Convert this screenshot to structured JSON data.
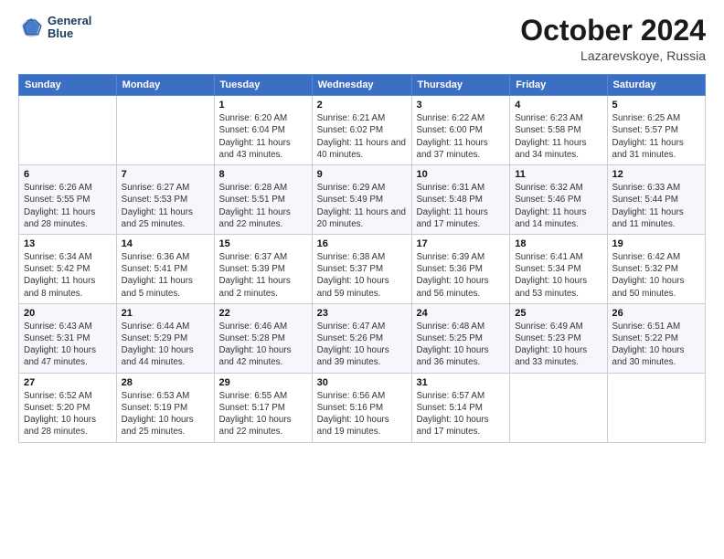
{
  "header": {
    "logo_line1": "General",
    "logo_line2": "Blue",
    "title": "October 2024",
    "subtitle": "Lazarevskoye, Russia"
  },
  "columns": [
    "Sunday",
    "Monday",
    "Tuesday",
    "Wednesday",
    "Thursday",
    "Friday",
    "Saturday"
  ],
  "weeks": [
    [
      {
        "day": "",
        "info": ""
      },
      {
        "day": "",
        "info": ""
      },
      {
        "day": "1",
        "info": "Sunrise: 6:20 AM\nSunset: 6:04 PM\nDaylight: 11 hours and 43 minutes."
      },
      {
        "day": "2",
        "info": "Sunrise: 6:21 AM\nSunset: 6:02 PM\nDaylight: 11 hours and 40 minutes."
      },
      {
        "day": "3",
        "info": "Sunrise: 6:22 AM\nSunset: 6:00 PM\nDaylight: 11 hours and 37 minutes."
      },
      {
        "day": "4",
        "info": "Sunrise: 6:23 AM\nSunset: 5:58 PM\nDaylight: 11 hours and 34 minutes."
      },
      {
        "day": "5",
        "info": "Sunrise: 6:25 AM\nSunset: 5:57 PM\nDaylight: 11 hours and 31 minutes."
      }
    ],
    [
      {
        "day": "6",
        "info": "Sunrise: 6:26 AM\nSunset: 5:55 PM\nDaylight: 11 hours and 28 minutes."
      },
      {
        "day": "7",
        "info": "Sunrise: 6:27 AM\nSunset: 5:53 PM\nDaylight: 11 hours and 25 minutes."
      },
      {
        "day": "8",
        "info": "Sunrise: 6:28 AM\nSunset: 5:51 PM\nDaylight: 11 hours and 22 minutes."
      },
      {
        "day": "9",
        "info": "Sunrise: 6:29 AM\nSunset: 5:49 PM\nDaylight: 11 hours and 20 minutes."
      },
      {
        "day": "10",
        "info": "Sunrise: 6:31 AM\nSunset: 5:48 PM\nDaylight: 11 hours and 17 minutes."
      },
      {
        "day": "11",
        "info": "Sunrise: 6:32 AM\nSunset: 5:46 PM\nDaylight: 11 hours and 14 minutes."
      },
      {
        "day": "12",
        "info": "Sunrise: 6:33 AM\nSunset: 5:44 PM\nDaylight: 11 hours and 11 minutes."
      }
    ],
    [
      {
        "day": "13",
        "info": "Sunrise: 6:34 AM\nSunset: 5:42 PM\nDaylight: 11 hours and 8 minutes."
      },
      {
        "day": "14",
        "info": "Sunrise: 6:36 AM\nSunset: 5:41 PM\nDaylight: 11 hours and 5 minutes."
      },
      {
        "day": "15",
        "info": "Sunrise: 6:37 AM\nSunset: 5:39 PM\nDaylight: 11 hours and 2 minutes."
      },
      {
        "day": "16",
        "info": "Sunrise: 6:38 AM\nSunset: 5:37 PM\nDaylight: 10 hours and 59 minutes."
      },
      {
        "day": "17",
        "info": "Sunrise: 6:39 AM\nSunset: 5:36 PM\nDaylight: 10 hours and 56 minutes."
      },
      {
        "day": "18",
        "info": "Sunrise: 6:41 AM\nSunset: 5:34 PM\nDaylight: 10 hours and 53 minutes."
      },
      {
        "day": "19",
        "info": "Sunrise: 6:42 AM\nSunset: 5:32 PM\nDaylight: 10 hours and 50 minutes."
      }
    ],
    [
      {
        "day": "20",
        "info": "Sunrise: 6:43 AM\nSunset: 5:31 PM\nDaylight: 10 hours and 47 minutes."
      },
      {
        "day": "21",
        "info": "Sunrise: 6:44 AM\nSunset: 5:29 PM\nDaylight: 10 hours and 44 minutes."
      },
      {
        "day": "22",
        "info": "Sunrise: 6:46 AM\nSunset: 5:28 PM\nDaylight: 10 hours and 42 minutes."
      },
      {
        "day": "23",
        "info": "Sunrise: 6:47 AM\nSunset: 5:26 PM\nDaylight: 10 hours and 39 minutes."
      },
      {
        "day": "24",
        "info": "Sunrise: 6:48 AM\nSunset: 5:25 PM\nDaylight: 10 hours and 36 minutes."
      },
      {
        "day": "25",
        "info": "Sunrise: 6:49 AM\nSunset: 5:23 PM\nDaylight: 10 hours and 33 minutes."
      },
      {
        "day": "26",
        "info": "Sunrise: 6:51 AM\nSunset: 5:22 PM\nDaylight: 10 hours and 30 minutes."
      }
    ],
    [
      {
        "day": "27",
        "info": "Sunrise: 6:52 AM\nSunset: 5:20 PM\nDaylight: 10 hours and 28 minutes."
      },
      {
        "day": "28",
        "info": "Sunrise: 6:53 AM\nSunset: 5:19 PM\nDaylight: 10 hours and 25 minutes."
      },
      {
        "day": "29",
        "info": "Sunrise: 6:55 AM\nSunset: 5:17 PM\nDaylight: 10 hours and 22 minutes."
      },
      {
        "day": "30",
        "info": "Sunrise: 6:56 AM\nSunset: 5:16 PM\nDaylight: 10 hours and 19 minutes."
      },
      {
        "day": "31",
        "info": "Sunrise: 6:57 AM\nSunset: 5:14 PM\nDaylight: 10 hours and 17 minutes."
      },
      {
        "day": "",
        "info": ""
      },
      {
        "day": "",
        "info": ""
      }
    ]
  ]
}
